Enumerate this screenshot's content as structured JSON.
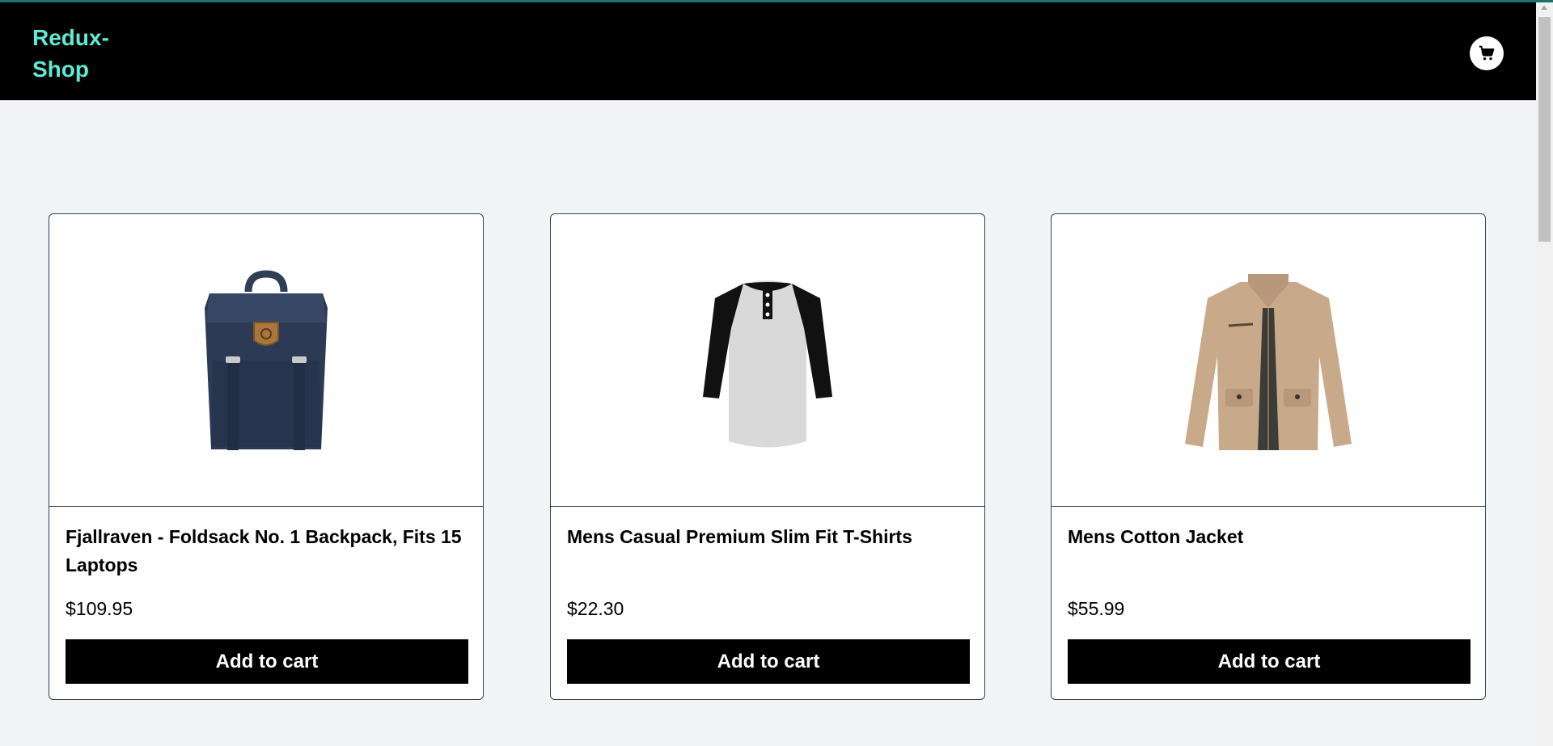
{
  "app": {
    "brand": "Redux-\nShop",
    "brand_line1": "Redux-",
    "brand_line2": "Shop"
  },
  "header": {
    "cart_icon": "shopping-cart-icon"
  },
  "products": [
    {
      "title": "Fjallraven - Foldsack No. 1 Backpack, Fits 15 Laptops",
      "price": "$109.95",
      "button": "Add to cart",
      "image": "backpack-image"
    },
    {
      "title": "Mens Casual Premium Slim Fit T-Shirts",
      "price": "$22.30",
      "button": "Add to cart",
      "image": "tshirt-image"
    },
    {
      "title": "Mens Cotton Jacket",
      "price": "$55.99",
      "button": "Add to cart",
      "image": "jacket-image"
    }
  ],
  "colors": {
    "brand": "#5eead4",
    "navbar": "#000000",
    "background": "#f3f4f6",
    "button": "#000000"
  }
}
